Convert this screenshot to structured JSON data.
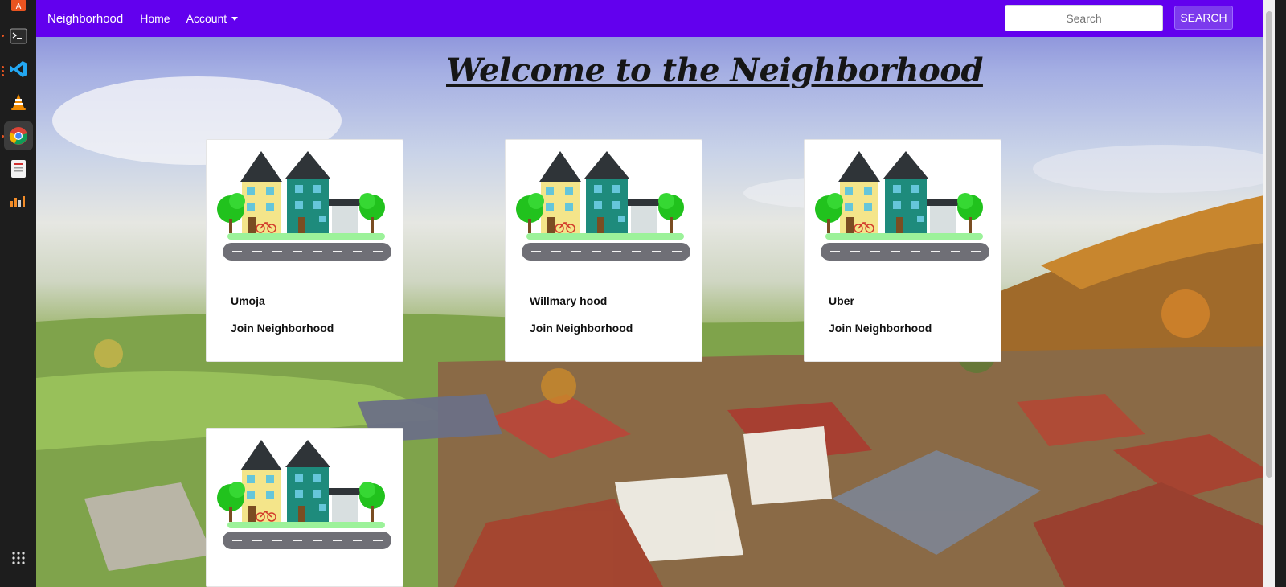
{
  "dock": {
    "items": [
      {
        "icon": "software-center-icon"
      },
      {
        "icon": "terminal-icon"
      },
      {
        "icon": "vscode-icon"
      },
      {
        "icon": "vlc-icon"
      },
      {
        "icon": "chrome-icon"
      },
      {
        "icon": "document-viewer-icon"
      },
      {
        "icon": "audio-mixer-icon"
      },
      {
        "icon": "app-grid-icon"
      }
    ]
  },
  "navbar": {
    "brand": "Neighborhood",
    "links": {
      "home": "Home",
      "account": "Account"
    },
    "search_placeholder": "Search",
    "search_button": "SEARCH",
    "color": "#6200ee"
  },
  "page": {
    "title": "Welcome to the Neighborhood"
  },
  "cards": [
    {
      "name": "Umoja",
      "action": "Join Neighborhood"
    },
    {
      "name": "Willmary hood",
      "action": "Join Neighborhood"
    },
    {
      "name": "Uber",
      "action": "Join Neighborhood"
    },
    {
      "name": "",
      "action": ""
    }
  ]
}
